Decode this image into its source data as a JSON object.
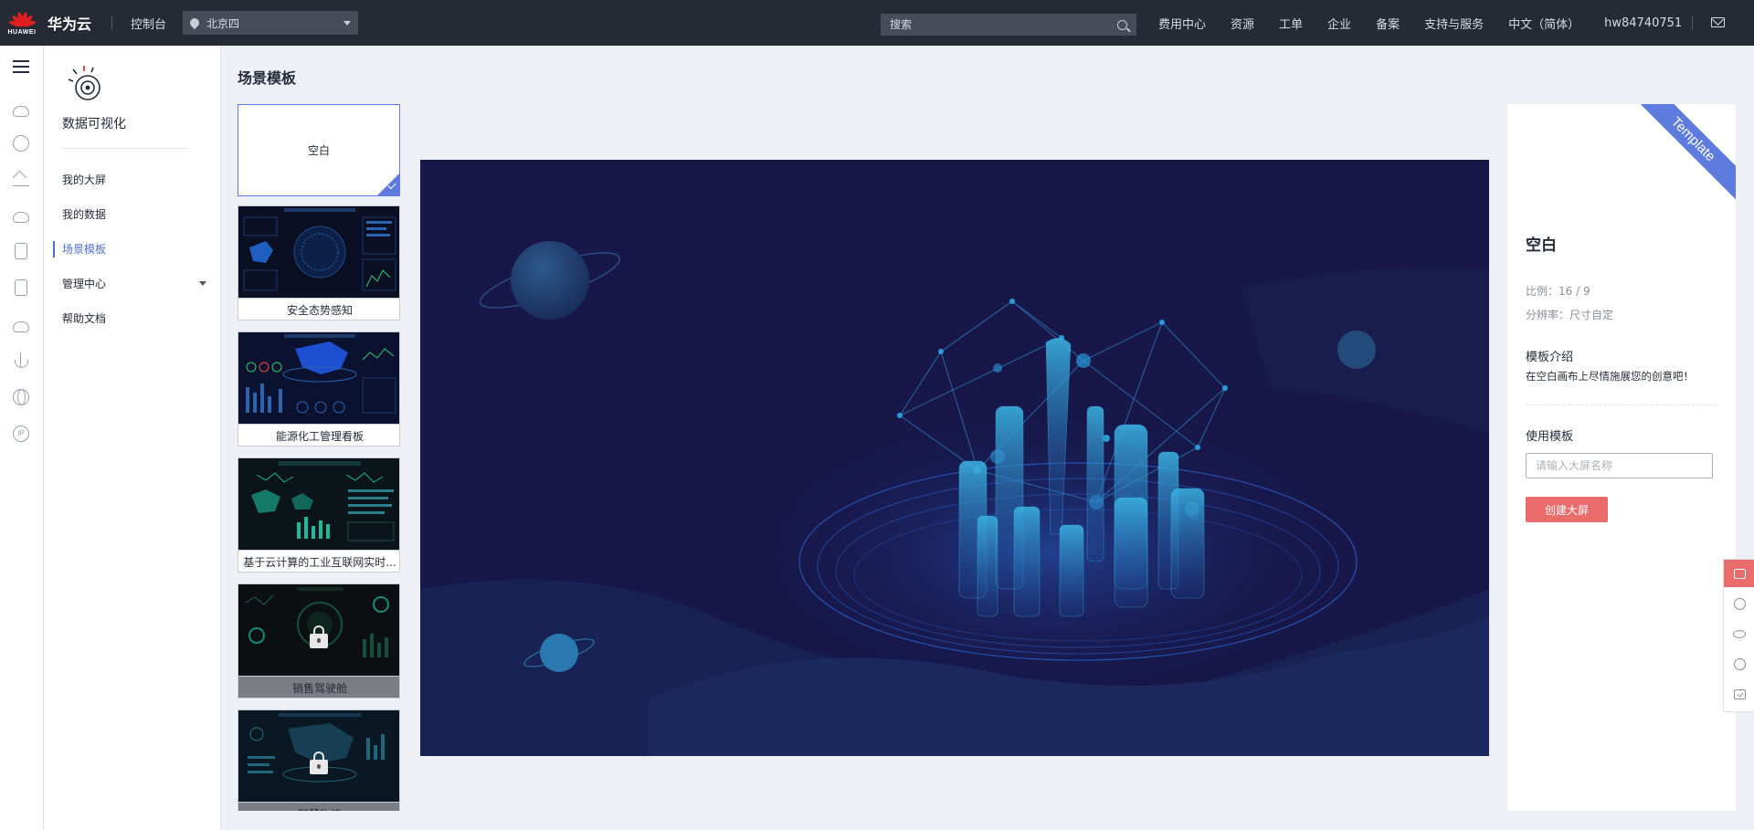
{
  "topbar": {
    "logo_text": "HUAWEI",
    "brand": "华为云",
    "console": "控制台",
    "region": "北京四",
    "search_placeholder": "搜索",
    "nav": [
      "费用中心",
      "资源",
      "工单",
      "企业",
      "备案",
      "支持与服务",
      "中文（简体）",
      "hw84740751"
    ]
  },
  "rail": {
    "icons": [
      "menu-icon",
      "cloud-server-icon",
      "network-icon",
      "storage-icon",
      "database-icon",
      "container-icon",
      "security-icon",
      "cloud-icon",
      "anchor-icon",
      "globe-icon",
      "ip-icon"
    ],
    "ip_label": "IP"
  },
  "sidebar": {
    "product_title": "数据可视化",
    "menu": [
      {
        "label": "我的大屏",
        "active": false
      },
      {
        "label": "我的数据",
        "active": false
      },
      {
        "label": "场景模板",
        "active": true
      },
      {
        "label": "管理中心",
        "active": false,
        "expandable": true
      },
      {
        "label": "帮助文档",
        "active": false
      }
    ]
  },
  "main": {
    "page_title": "场景模板",
    "templates": [
      {
        "label": "空白",
        "selected": true,
        "locked": false
      },
      {
        "label": "安全态势感知",
        "selected": false,
        "locked": false
      },
      {
        "label": "能源化工管理看板",
        "selected": false,
        "locked": false
      },
      {
        "label": "基于云计算的工业互联网实时...",
        "selected": false,
        "locked": false
      },
      {
        "label": "销售驾驶舱",
        "selected": false,
        "locked": true
      },
      {
        "label": "智慧物流",
        "selected": false,
        "locked": true
      }
    ]
  },
  "detail": {
    "ribbon": "Template",
    "title": "空白",
    "ratio": "比例：16 / 9",
    "resolution": "分辨率：尺寸自定",
    "intro_heading": "模板介绍",
    "intro_text": "在空白画布上尽情施展您的创意吧！",
    "use_heading": "使用模板",
    "name_placeholder": "请输入大屏名称",
    "create_button": "创建大屏"
  },
  "colors": {
    "topbar": "#252a35",
    "accent": "#5e7ce0",
    "danger": "#ea6b6b",
    "preview_bg": "#17174a"
  }
}
